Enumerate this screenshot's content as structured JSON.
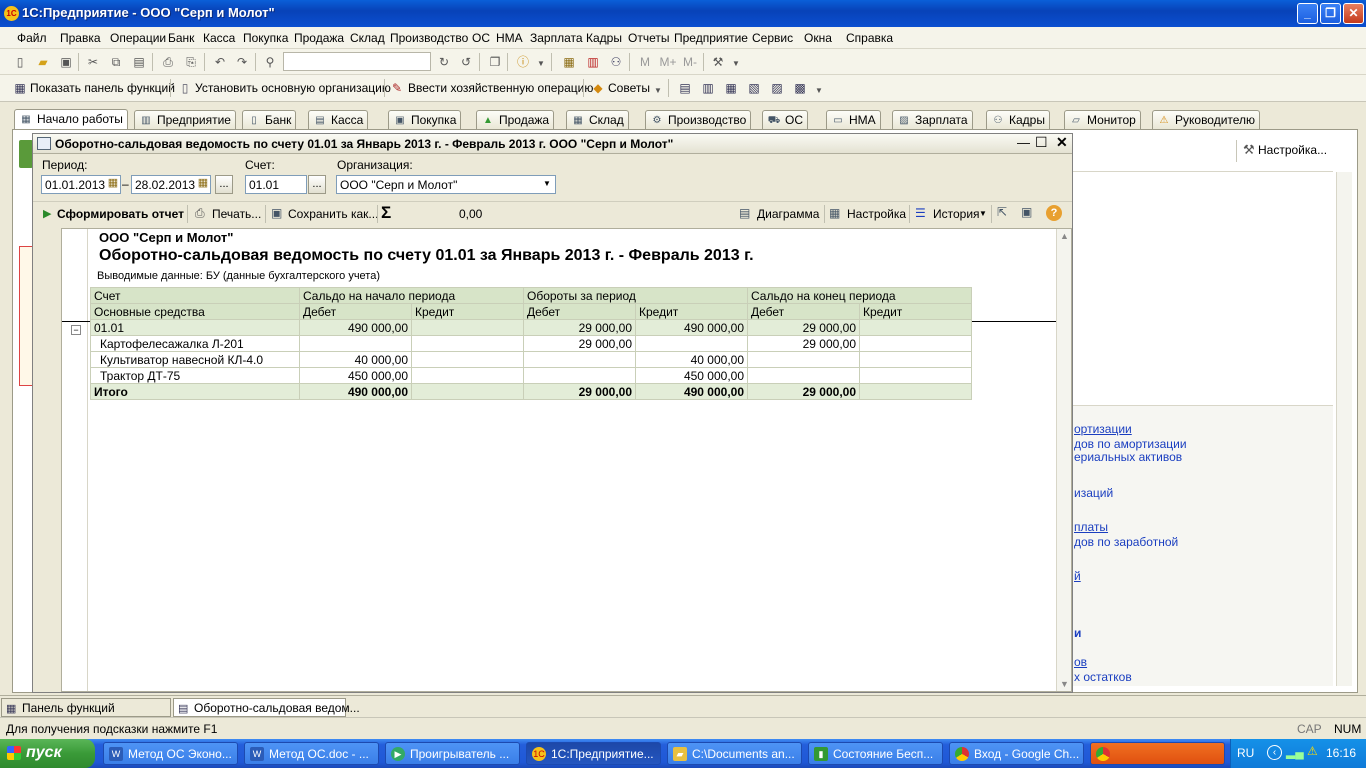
{
  "app": {
    "title": "1С:Предприятие - ООО \"Серп и Молот\"",
    "icon_text": "1С"
  },
  "menu": [
    "Файл",
    "Правка",
    "Операции",
    "Банк",
    "Касса",
    "Покупка",
    "Продажа",
    "Склад",
    "Производство",
    "ОС",
    "НМА",
    "Зарплата",
    "Кадры",
    "Отчеты",
    "Предприятие",
    "Сервис",
    "Окна",
    "Справка"
  ],
  "toolbar2": {
    "show_panel": "Показать панель функций",
    "set_org": "Установить основную организацию",
    "enter_op": "Ввести хозяйственную операцию",
    "tips": "Советы"
  },
  "tabs": [
    "Начало работы",
    "Предприятие",
    "Банк",
    "Касса",
    "Покупка",
    "Продажа",
    "Склад",
    "Производство",
    "ОС",
    "НМА",
    "Зарплата",
    "Кадры",
    "Монитор",
    "Руководителю"
  ],
  "right_panel": {
    "settings": "Настройка...",
    "links": [
      "ортизации",
      "дов по амортизации",
      "ериальных активов",
      "изаций",
      "платы",
      "дов по заработной",
      "й",
      "и",
      "ов",
      "х остатков"
    ]
  },
  "report_window": {
    "title": "Оборотно-сальдовая ведомость по счету 01.01 за Январь 2013 г. - Февраль 2013 г. ООО \"Серп и Молот\"",
    "period_label": "Период:",
    "date_from": "01.01.2013",
    "date_dash": "–",
    "date_to": "28.02.2013",
    "account_label": "Счет:",
    "account": "01.01",
    "org_label": "Организация:",
    "org": "ООО \"Серп и Молот\"",
    "btn_generate": "Сформировать отчет",
    "btn_print": "Печать...",
    "btn_save": "Сохранить как...",
    "sigma": "Σ",
    "sum": "0,00",
    "btn_chart": "Диаграмма",
    "btn_settings": "Настройка",
    "btn_history": "История"
  },
  "report": {
    "org": "ООО \"Серп и Молот\"",
    "title": "Оборотно-сальдовая ведомость по счету 01.01 за Январь 2013 г. - Февраль 2013 г.",
    "output": "Выводимые данные:  БУ (данные бухгалтерского учета)",
    "header1": [
      "Счет",
      "Сальдо на начало периода",
      "Обороты за период",
      "Сальдо на конец периода"
    ],
    "header2": [
      "Основные средства",
      "Дебет",
      "Кредит",
      "Дебет",
      "Кредит",
      "Дебет",
      "Кредит"
    ],
    "account_row": [
      "01.01",
      "490 000,00",
      "",
      "29 000,00",
      "490 000,00",
      "29 000,00",
      ""
    ],
    "rows": [
      [
        "Картофелесажалка Л-201",
        "",
        "",
        "29 000,00",
        "",
        "29 000,00",
        ""
      ],
      [
        "Культиватор навесной КЛ-4.0",
        "40 000,00",
        "",
        "",
        "40 000,00",
        "",
        ""
      ],
      [
        "Трактор ДТ-75",
        "450 000,00",
        "",
        "",
        "450 000,00",
        "",
        ""
      ]
    ],
    "total": [
      "Итого",
      "490 000,00",
      "",
      "29 000,00",
      "490 000,00",
      "29 000,00",
      ""
    ]
  },
  "window_tabs": [
    "Панель функций",
    "Оборотно-сальдовая ведом..."
  ],
  "status": {
    "hint": "Для получения подсказки нажмите F1",
    "cap": "CAP",
    "num": "NUM"
  },
  "taskbar": {
    "start": "пуск",
    "items": [
      "Метод ОС Эконо...",
      "Метод ОС.doc - ...",
      "Проигрыватель ...",
      "1С:Предприятие...",
      "C:\\Documents an...",
      "Состояние Бесп...",
      "Вход - Google Ch...",
      ""
    ],
    "lang": "RU",
    "time": "16:16"
  }
}
